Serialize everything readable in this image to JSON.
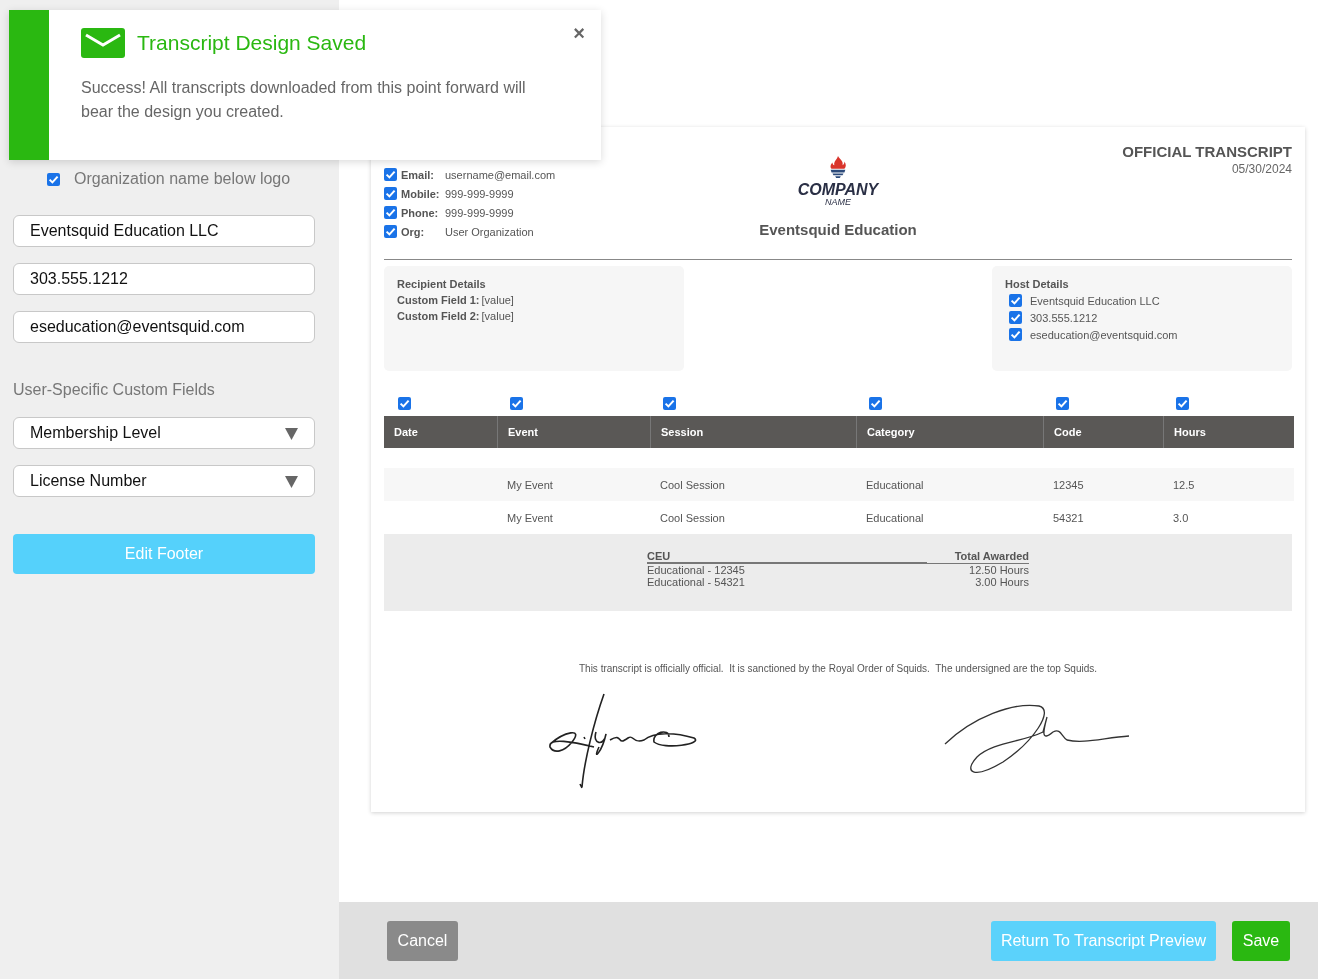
{
  "toast": {
    "title": "Transcript Design Saved",
    "message": "Success! All transcripts downloaded from this point forward will bear the design you created.",
    "close": "×"
  },
  "sidebar": {
    "org_below_logo": {
      "label": "Organization name below logo",
      "checked": true
    },
    "fields": [
      {
        "value": "Eventsquid Education LLC"
      },
      {
        "value": "303.555.1212"
      },
      {
        "value": "eseducation@eventsquid.com"
      }
    ],
    "section_label": "User-Specific Custom Fields",
    "custom_fields": [
      {
        "label": "Membership Level"
      },
      {
        "label": "License Number"
      }
    ],
    "edit_footer_button": "Edit Footer"
  },
  "transcript": {
    "contact": [
      {
        "label": "Email:",
        "value": "username@email.com",
        "checked": true
      },
      {
        "label": "Mobile:",
        "value": "999-999-9999",
        "checked": true
      },
      {
        "label": "Phone:",
        "value": "999-999-9999",
        "checked": true
      },
      {
        "label": "Org:",
        "value": "User Organization",
        "checked": true
      }
    ],
    "logo": {
      "word": "COMPANY",
      "sub": "NAME"
    },
    "org_name": "Eventsquid Education",
    "title": "OFFICIAL TRANSCRIPT",
    "date": "05/30/2024",
    "recipient": {
      "title": "Recipient Details",
      "fields": [
        {
          "label": "Custom Field 1:",
          "value": "[value]"
        },
        {
          "label": "Custom Field 2:",
          "value": "[value]"
        }
      ]
    },
    "host": {
      "title": "Host Details",
      "items": [
        {
          "text": "Eventsquid Education LLC",
          "checked": true
        },
        {
          "text": "303.555.1212",
          "checked": true
        },
        {
          "text": "eseducation@eventsquid.com",
          "checked": true
        }
      ]
    },
    "columns": [
      {
        "label": "Date",
        "checked": true
      },
      {
        "label": "Event",
        "checked": true
      },
      {
        "label": "Session",
        "checked": true
      },
      {
        "label": "Category",
        "checked": true
      },
      {
        "label": "Code",
        "checked": true
      },
      {
        "label": "Hours",
        "checked": true
      }
    ],
    "rows": [
      {
        "event": "My Event",
        "session": "Cool Session",
        "category": "Educational",
        "code": "12345",
        "hours": "12.5"
      },
      {
        "event": "My Event",
        "session": "Cool Session",
        "category": "Educational",
        "code": "54321",
        "hours": "3.0"
      }
    ],
    "summary": {
      "headers": [
        "CEU",
        "Total Awarded"
      ],
      "rows": [
        [
          "Educational - 12345",
          "12.50 Hours"
        ],
        [
          "Educational - 54321",
          "3.00 Hours"
        ]
      ]
    },
    "footer_text": "This transcript is officially official.  It is sanctioned by the Royal Order of Squids.  The undersigned are the top Squids."
  },
  "actions": {
    "cancel": "Cancel",
    "return": "Return To Transcript Preview",
    "save": "Save"
  }
}
